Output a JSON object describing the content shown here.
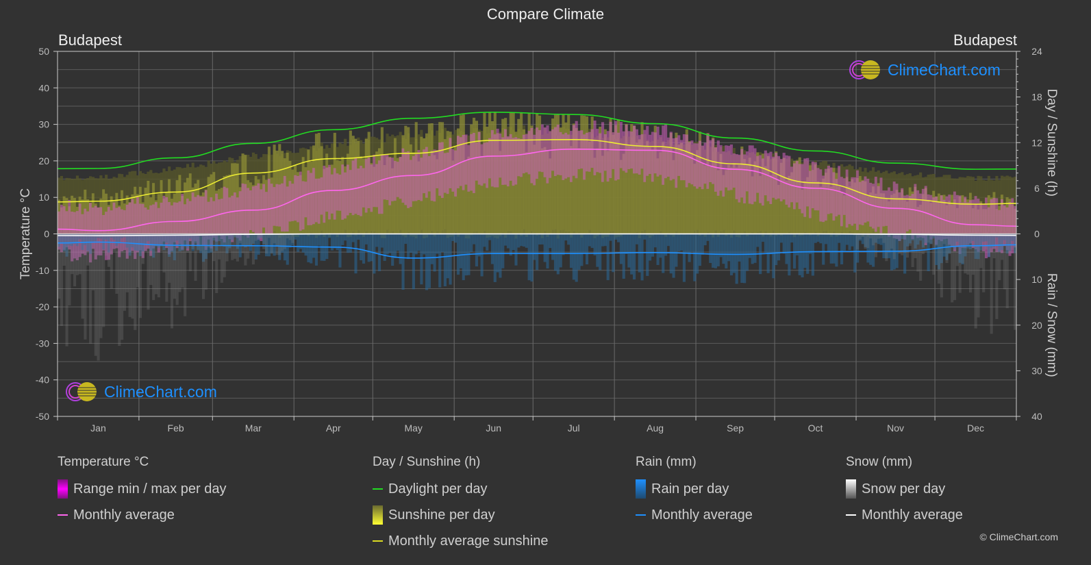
{
  "title": "Compare Climate",
  "city_left": "Budapest",
  "city_right": "Budapest",
  "logo_text": "ClimeChart.com",
  "copyright": "© ClimeChart.com",
  "colors": {
    "background": "#323232",
    "temperature_avg": "#ff66ee",
    "temperature_range": "#e000e0",
    "daylight": "#22dd22",
    "sunshine_avg": "#eeee33",
    "sunshine_bar": "#b5b530",
    "rain": "#1e90ff",
    "snow": "#ffffff",
    "grid": "#5a5a5a"
  },
  "legend": {
    "temperature": {
      "heading": "Temperature °C",
      "items": [
        "Range min / max per day",
        "Monthly average"
      ]
    },
    "sunshine": {
      "heading": "Day / Sunshine (h)",
      "items": [
        "Daylight per day",
        "Sunshine per day",
        "Monthly average sunshine"
      ]
    },
    "rain": {
      "heading": "Rain (mm)",
      "items": [
        "Rain per day",
        "Monthly average"
      ]
    },
    "snow": {
      "heading": "Snow (mm)",
      "items": [
        "Snow per day",
        "Monthly average"
      ]
    }
  },
  "chart_data": {
    "type": "line",
    "title": "Compare Climate",
    "categories": [
      "Jan",
      "Feb",
      "Mar",
      "Apr",
      "May",
      "Jun",
      "Jul",
      "Aug",
      "Sep",
      "Oct",
      "Nov",
      "Dec"
    ],
    "left_axis": {
      "label": "Temperature °C",
      "range": [
        -50,
        50
      ],
      "ticks": [
        50,
        40,
        30,
        20,
        10,
        0,
        -10,
        -20,
        -30,
        -40,
        -50
      ]
    },
    "right_axis_top": {
      "label": "Day / Sunshine (h)",
      "range": [
        0,
        24
      ],
      "ticks": [
        24,
        18,
        12,
        6,
        0
      ]
    },
    "right_axis_bottom": {
      "label": "Rain / Snow (mm)",
      "range": [
        0,
        40
      ],
      "ticks": [
        0,
        10,
        20,
        30,
        40
      ]
    },
    "grid": true,
    "series": [
      {
        "name": "Temperature monthly average",
        "axis": "temperature",
        "unit": "°C",
        "values": [
          0.9,
          3.4,
          6.5,
          11.9,
          16.0,
          21.3,
          23.2,
          22.9,
          17.7,
          12.5,
          7.0,
          2.5
        ]
      },
      {
        "name": "Daylight per day",
        "axis": "sunshine",
        "unit": "h",
        "values": [
          8.6,
          10.0,
          11.9,
          13.7,
          15.2,
          16.0,
          15.7,
          14.5,
          12.6,
          10.9,
          9.3,
          8.5
        ]
      },
      {
        "name": "Monthly average sunshine",
        "axis": "sunshine",
        "unit": "h",
        "values": [
          4.3,
          5.5,
          8.0,
          9.9,
          10.6,
          12.3,
          12.4,
          11.5,
          9.2,
          6.7,
          4.6,
          3.9
        ]
      },
      {
        "name": "Rain monthly average",
        "axis": "rain",
        "unit": "mm",
        "values": [
          1.8,
          2.5,
          2.6,
          2.9,
          5.3,
          4.3,
          4.3,
          4.1,
          4.5,
          3.9,
          3.8,
          2.6
        ]
      },
      {
        "name": "Snow monthly average",
        "axis": "rain",
        "unit": "mm",
        "values": [
          0.4,
          0.3,
          0.1,
          0.0,
          0.0,
          0.0,
          0.0,
          0.0,
          0.0,
          0.0,
          0.1,
          0.3
        ]
      }
    ]
  }
}
